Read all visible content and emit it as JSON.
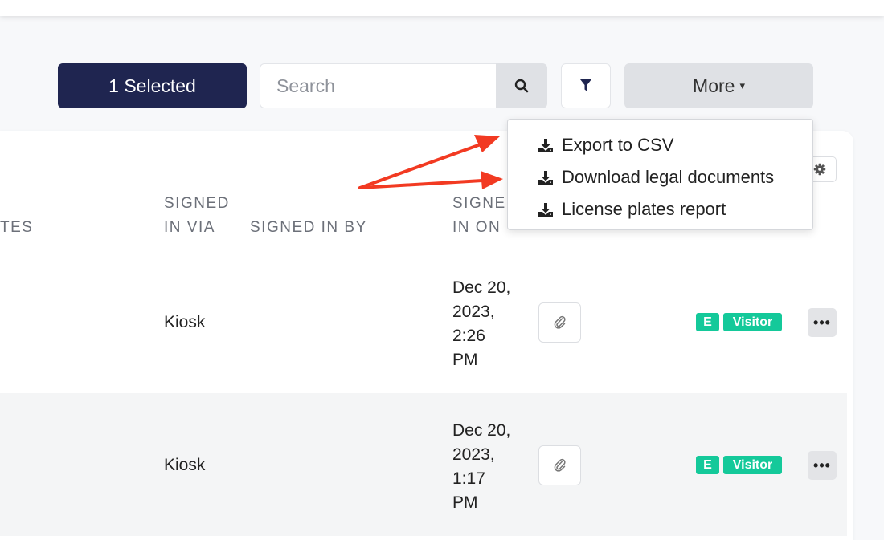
{
  "toolbar": {
    "selected_label": "1 Selected",
    "search_placeholder": "Search",
    "search_icon": "search-icon",
    "filter_icon": "filter-icon",
    "more_label": "More",
    "more_caret": "▾"
  },
  "dropdown": {
    "items": [
      {
        "label": "Export to CSV",
        "icon": "download-icon"
      },
      {
        "label": "Download legal documents",
        "icon": "download-icon"
      },
      {
        "label": "License plates report",
        "icon": "download-icon"
      }
    ]
  },
  "table": {
    "headers": {
      "notes_partial": "TES",
      "signed_in_via_line1": "SIGNED",
      "signed_in_via_line2": "IN VIA",
      "signed_in_by": "SIGNED IN BY",
      "signed_in_on_line1": "SIGNED",
      "signed_in_on_line2": "IN ON"
    },
    "rows": [
      {
        "signed_in_via": "Kiosk",
        "signed_in_on": [
          "Dec 20,",
          "2023,",
          "2:26",
          "PM"
        ],
        "badge_e": "E",
        "badge_type": "Visitor",
        "more": "•••"
      },
      {
        "signed_in_via": "Kiosk",
        "signed_in_on": [
          "Dec 20,",
          "2023,",
          "1:17",
          "PM"
        ],
        "badge_e": "E",
        "badge_type": "Visitor",
        "more": "•••"
      }
    ]
  },
  "colors": {
    "primary": "#1f2550",
    "badge": "#14c99a",
    "annotation_arrow": "#f23a22"
  }
}
